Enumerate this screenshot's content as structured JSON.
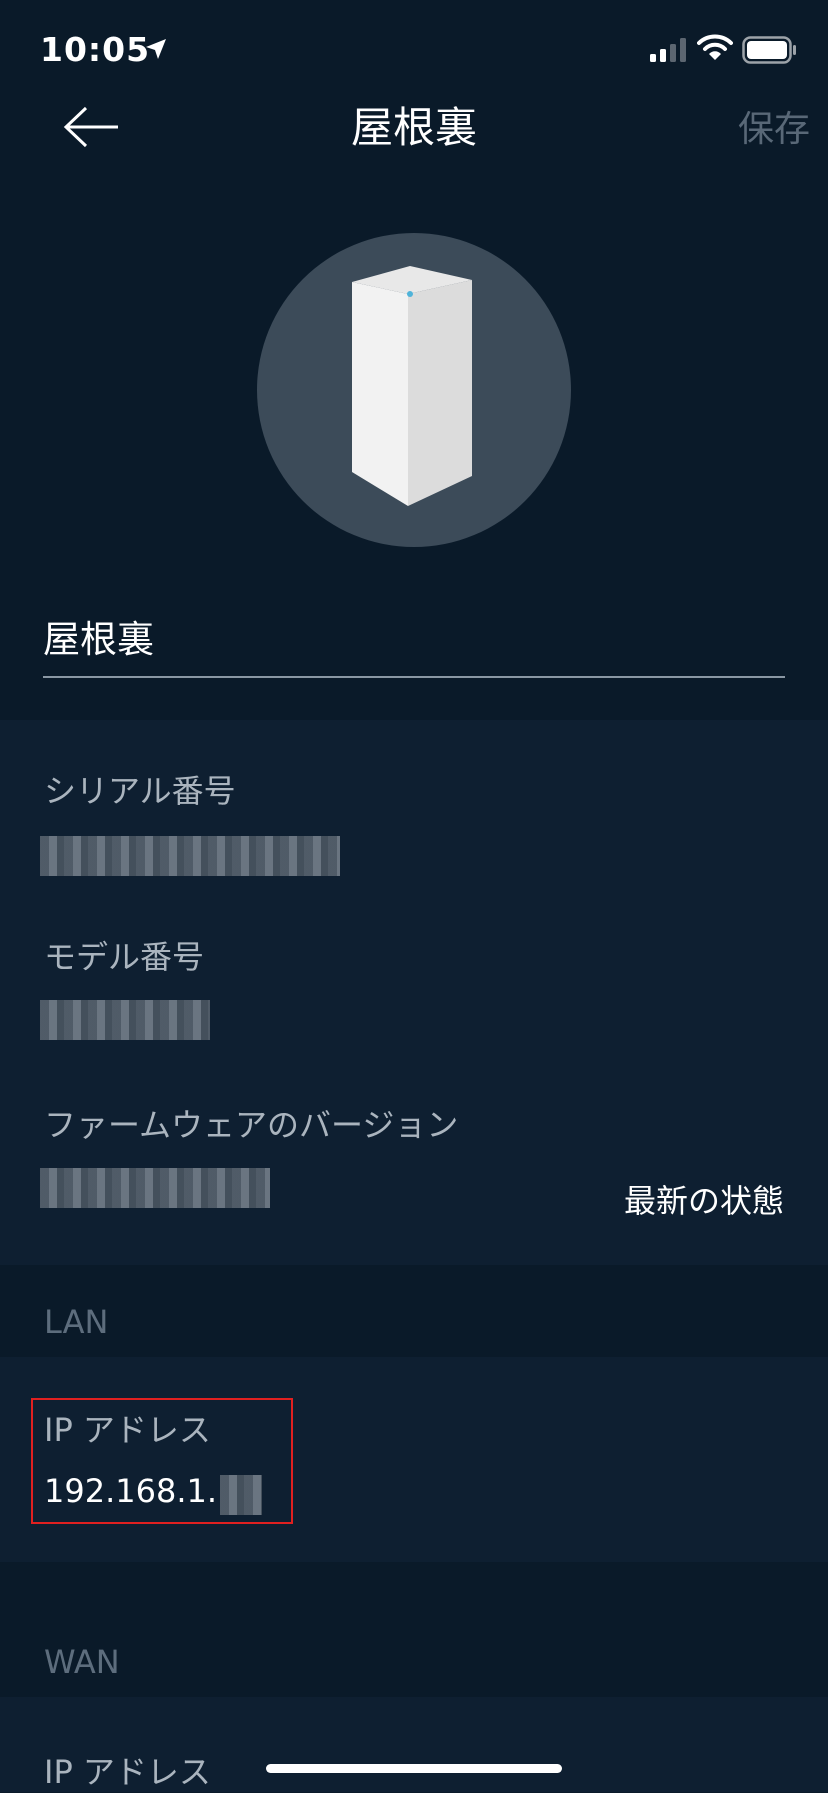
{
  "status_bar": {
    "time": "10:05",
    "icons": [
      "location-arrow-icon",
      "signal-icon",
      "wifi-icon",
      "battery-icon"
    ]
  },
  "nav": {
    "title": "屋根裏",
    "save_label": "保存",
    "back_icon": "back-arrow-icon"
  },
  "device": {
    "image_icon": "router-node-icon",
    "name_value": "屋根裏"
  },
  "details": {
    "serial_label": "シリアル番号",
    "model_label": "モデル番号",
    "firmware_label": "ファームウェアのバージョン",
    "firmware_status": "最新の状態"
  },
  "lan": {
    "header": "LAN",
    "ip_label": "IP アドレス",
    "ip_value": "192.168.1."
  },
  "wan": {
    "header": "WAN",
    "ip_label": "IP アドレス"
  },
  "colors": {
    "background": "#0a1a29",
    "section": "#0e1f31",
    "highlight": "#e02020",
    "muted_text": "#aab4be"
  }
}
